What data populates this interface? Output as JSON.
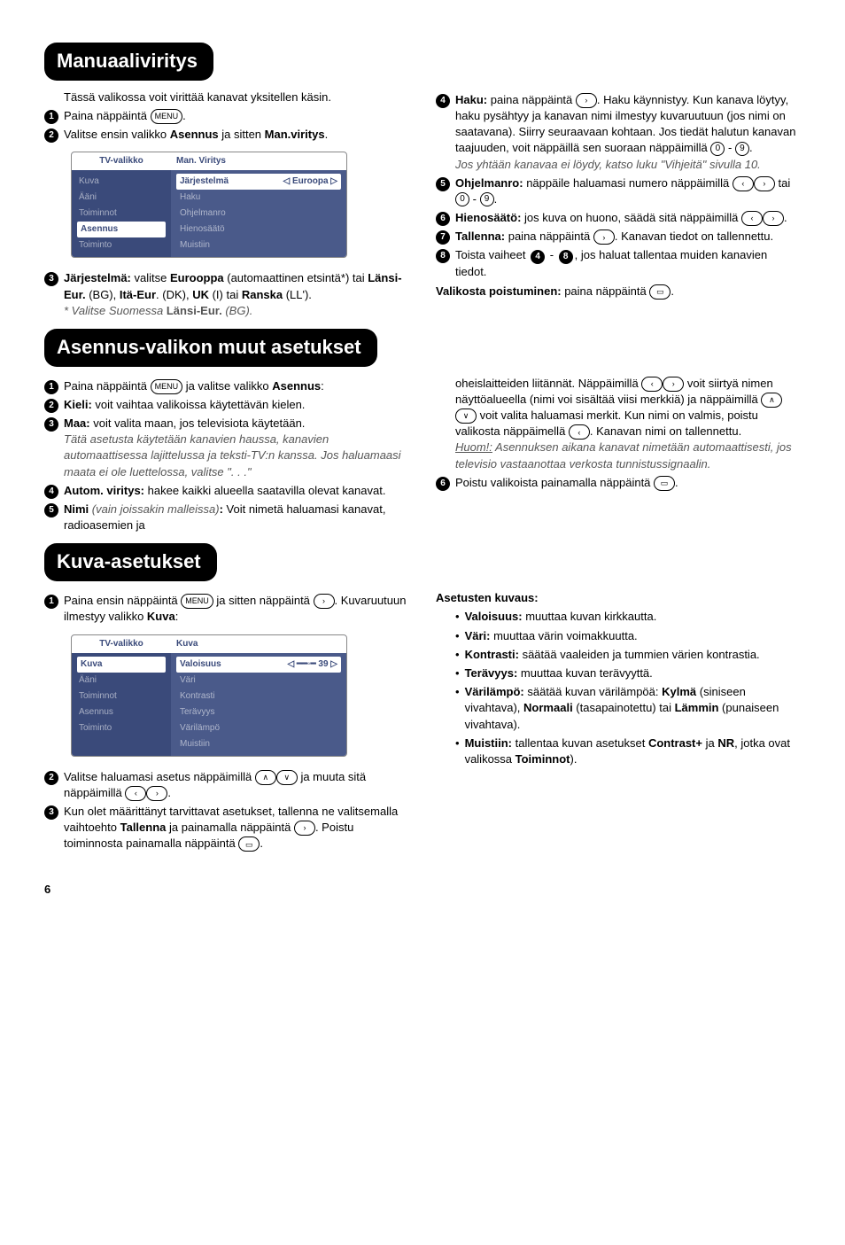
{
  "sections": {
    "manual": {
      "title": "Manuaaliviritys",
      "intro": "Tässä valikossa voit virittää kanavat yksitellen käsin.",
      "step1": "Paina näppäintä",
      "step2a": "Valitse ensin valikko ",
      "step2b": "Asennus",
      "step2c": " ja sitten ",
      "step2d": "Man.viritys",
      "step3_label": "Järjestelmä:",
      "step3a": " valitse ",
      "step3b": "Eurooppa",
      "step3c": " (automaattinen etsintä*) tai ",
      "step3d": "Länsi-Eur.",
      "step3e": " (BG), ",
      "step3f": "Itä-Eur",
      "step3g": ". (DK), ",
      "step3h": "UK",
      "step3i": " (I) tai ",
      "step3j": "Ranska",
      "step3k": " (LL').",
      "step3_note_a": "* Valitse Suomessa ",
      "step3_note_b": "Länsi-Eur.",
      "step3_note_c": " (BG).",
      "step4_label": "Haku:",
      "step4a": " paina näppäintä ",
      "step4b": ". Haku käynnistyy. Kun kanava löytyy, haku pysähtyy ja kanavan nimi ilmestyy kuvaruutuun (jos nimi on saatavana). Siirry seuraavaan kohtaan. Jos tiedät halutun kanavan taajuuden, voit näppäillä sen suoraan näppäimillä ",
      "step4_note": "Jos yhtään kanavaa ei löydy, katso luku \"Vihjeitä\" sivulla 10.",
      "step5_label": "Ohjelmanro:",
      "step5a": " näppäile haluamasi numero näppäimillä ",
      "step5b": " tai ",
      "step6_label": "Hienosäätö:",
      "step6a": " jos kuva on huono, säädä sitä näppäimillä ",
      "step7_label": "Tallenna:",
      "step7a": " paina näppäintä ",
      "step7b": ". Kanavan tiedot on tallennettu.",
      "step8a": "Toista vaiheet ",
      "step8b": " - ",
      "step8c": ", jos haluat tallentaa muiden kanavien tiedot.",
      "exit_label": "Valikosta poistuminen:",
      "exit_a": " paina näppäintä ",
      "menu": {
        "left_title": "TV-valikko",
        "left_items": [
          "Kuva",
          "Ääni",
          "Toiminnot",
          "Asennus",
          "Toiminto"
        ],
        "left_sel": "Asennus",
        "right_title": "Man. Viritys",
        "right_items": [
          "Järjestelmä",
          "Haku",
          "Ohjelmanro",
          "Hienosäätö",
          "Muistiin"
        ],
        "right_val": "Euroopa"
      }
    },
    "asennus": {
      "title": "Asennus-valikon muut asetukset",
      "s1a": "Paina näppäintä ",
      "s1b": " ja valitse valikko ",
      "s1c": "Asennus",
      "s2_label": "Kieli:",
      "s2a": " voit vaihtaa valikoissa käytettävän kielen.",
      "s3_label": "Maa:",
      "s3a": " voit valita maan, jos televisiota käytetään.",
      "s3_note": "Tätä asetusta käytetään kanavien haussa, kanavien automaattisessa lajittelussa ja teksti-TV:n kanssa. Jos haluamaasi maata ei ole luettelossa, valitse \". . .\"",
      "s4_label": "Autom. viritys:",
      "s4a": " hakee kaikki alueella saatavilla olevat kanavat.",
      "s5_label": "Nimi",
      "s5_paren": " (vain joissakin malleissa)",
      "s5a": " Voit nimetä haluamasi kanavat, radioasemien ja",
      "right_a": "oheislaitteiden liitännät. Näppäimillä ",
      "right_b": " voit siirtyä nimen näyttöalueella (nimi voi sisältää viisi merkkiä) ja näppäimillä ",
      "right_c": " voit valita haluamasi merkit. Kun nimi on valmis, poistu valikosta näppäimellä ",
      "right_d": ". Kanavan nimi on tallennettu.",
      "right_note_label": "Huom!:",
      "right_note": " Asennuksen aikana kanavat nimetään automaattisesti, jos televisio vastaanottaa verkosta tunnistussignaalin.",
      "s6a": "Poistu valikoista painamalla näppäintä "
    },
    "kuva": {
      "title": "Kuva-asetukset",
      "s1a": "Paina ensin näppäintä ",
      "s1b": " ja sitten näppäintä ",
      "s1c": ". Kuvaruutuun ilmestyy valikko ",
      "s1d": "Kuva",
      "s2a": "Valitse haluamasi asetus näppäimillä ",
      "s2b": " ja muuta sitä näppäimillä ",
      "s3a": "Kun olet määrittänyt tarvittavat asetukset, tallenna ne valitsemalla vaihtoehto ",
      "s3b": "Tallenna",
      "s3c": " ja painamalla näppäintä ",
      "s3d": ". Poistu toiminnosta painamalla näppäintä ",
      "desc_title": "Asetusten kuvaus:",
      "b1_label": "Valoisuus:",
      "b1": " muuttaa kuvan kirkkautta.",
      "b2_label": "Väri:",
      "b2": " muuttaa värin voimakkuutta.",
      "b3_label": "Kontrasti:",
      "b3": " säätää vaaleiden ja tummien värien kontrastia.",
      "b4_label": "Terävyys:",
      "b4": " muuttaa kuvan terävyyttä.",
      "b5_label": "Värilämpö:",
      "b5a": " säätää kuvan värilämpöä: ",
      "b5b": "Kylmä",
      "b5c": " (siniseen vivahtava), ",
      "b5d": "Normaali",
      "b5e": " (tasapainotettu) tai ",
      "b5f": "Lämmin",
      "b5g": " (punaiseen vivahtava).",
      "b6_label": "Muistiin:",
      "b6a": " tallentaa kuvan asetukset ",
      "b6b": "Contrast+",
      "b6c": " ja ",
      "b6d": "NR",
      "b6e": ", jotka ovat valikossa ",
      "b6f": "Toiminnot",
      "menu": {
        "left_title": "TV-valikko",
        "left_items": [
          "Kuva",
          "Ääni",
          "Toiminnot",
          "Asennus",
          "Toiminto"
        ],
        "left_sel": "Kuva",
        "right_title": "Kuva",
        "right_items": [
          "Valoisuus",
          "Väri",
          "Kontrasti",
          "Terävyys",
          "Värilämpö",
          "Muistiin"
        ],
        "right_val": "39"
      }
    }
  },
  "keys": {
    "menu": "MENU",
    "zero": "0",
    "nine": "9",
    "left": "‹",
    "right": "›",
    "up": "∧",
    "down": "∨",
    "tv": "▭"
  },
  "pagenum": "6"
}
